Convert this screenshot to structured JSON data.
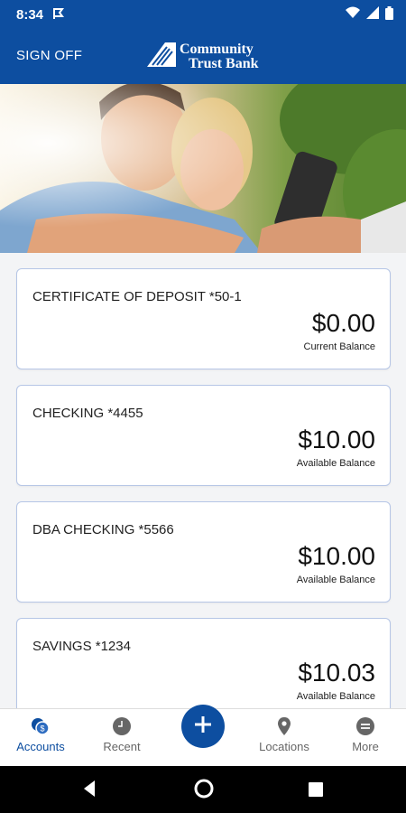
{
  "status_bar": {
    "time": "8:34",
    "flag_icon": "flag-icon",
    "icons": [
      "wifi-icon",
      "signal-icon",
      "battery-icon"
    ]
  },
  "header": {
    "sign_off_label": "SIGN OFF",
    "logo_line1": "Community",
    "logo_line2": "Trust Bank"
  },
  "hero": {
    "image_description": "couple-taking-selfie"
  },
  "accounts": [
    {
      "name": "CERTIFICATE OF DEPOSIT *50-1",
      "amount": "$0.00",
      "balance_label": "Current Balance"
    },
    {
      "name": "CHECKING *4455",
      "amount": "$10.00",
      "balance_label": "Available Balance"
    },
    {
      "name": "DBA CHECKING *5566",
      "amount": "$10.00",
      "balance_label": "Available Balance"
    },
    {
      "name": "SAVINGS *1234",
      "amount": "$10.03",
      "balance_label": "Available Balance"
    }
  ],
  "bottom_nav": {
    "accounts": "Accounts",
    "recent": "Recent",
    "locations": "Locations",
    "more": "More"
  },
  "colors": {
    "brand_blue": "#0d4ea0",
    "card_border": "#b6c6e6"
  }
}
